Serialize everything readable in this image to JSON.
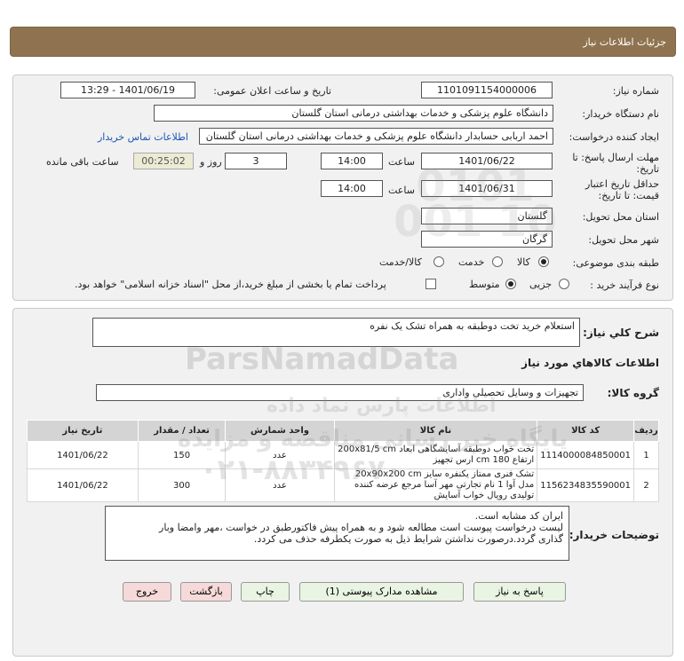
{
  "header": {
    "title": "جزئیات اطلاعات نیاز"
  },
  "info": {
    "need_number_label": "شماره نیاز:",
    "need_number": "1101091154000006",
    "announce_label": "تاریخ و ساعت اعلان عمومی:",
    "announce_value": "1401/06/19 - 13:29",
    "buyer_org_label": "نام دستگاه خریدار:",
    "buyer_org": "دانشگاه علوم پزشکی و خدمات بهداشتی درمانی استان گلستان",
    "creator_label": "ایجاد کننده درخواست:",
    "creator": "احمد اربابی حسابدار دانشگاه علوم پزشکی و خدمات بهداشتی درمانی استان گلستان",
    "contact_link": "اطلاعات تماس خریدار",
    "deadline_label_1": "مهلت ارسال پاسخ: تا",
    "deadline_label_2": "تاریخ:",
    "deadline_date": "1401/06/22",
    "time_label": "ساعت",
    "deadline_time": "14:00",
    "days_value": "3",
    "days_label": "روز و",
    "countdown": "00:25:02",
    "remaining_label": "ساعت باقی مانده",
    "validity_label_1": "حداقل تاریخ اعتبار",
    "validity_label_2": "قیمت: تا تاریخ:",
    "validity_date": "1401/06/31",
    "validity_time": "14:00",
    "province_label": "استان محل تحویل:",
    "province": "گلستان",
    "city_label": "شهر محل تحویل:",
    "city": "گرگان",
    "category_label": "طبقه بندی موضوعی:",
    "category_options": [
      "کالا",
      "خدمت",
      "کالا/خدمت"
    ],
    "process_label": "نوع فرآیند خرید :",
    "process_options": [
      "جزیی",
      "متوسط"
    ],
    "payment_note": "پرداخت تمام یا بخشی از مبلغ خرید،از محل \"اسناد خزانه اسلامی\" خواهد بود."
  },
  "summary": {
    "label": "شرح کلي نياز:",
    "value": "استعلام خرید تخت دوطبقه به همراه تشک یک نفره"
  },
  "goods": {
    "section_title": "اطلاعات کالاهاي مورد نياز",
    "group_label": "گروه کالا:",
    "group_value": "تجهیزات و وسایل تحصیلی واداری"
  },
  "table": {
    "headers": [
      "ردیف",
      "کد کالا",
      "نام کالا",
      "واحد شمارش",
      "تعداد / مقدار",
      "تاریخ نیاز"
    ],
    "rows": [
      {
        "index": "1",
        "code": "1114000084850001",
        "name": "تخت خواب دوطبقه آسایشگاهی ابعاد 200x81/5 cm ارتفاع 180 cm ارس تجهیز",
        "unit": "عدد",
        "qty": "150",
        "date": "1401/06/22"
      },
      {
        "index": "2",
        "code": "1156234835590001",
        "name": "تشک فنری ممتاز یکنفره سایز 20x90x200 cm مدل آوا 1 نام تجارتی مهر آسا مرجع عرضه کننده تولیدی رویال خواب آسایش",
        "unit": "عدد",
        "qty": "300",
        "date": "1401/06/22"
      }
    ]
  },
  "buyer_notes": {
    "label": "توضیحات خریدار:",
    "lines": [
      "ایران کد مشابه است.",
      "لیست درخواست پیوست است مطالعه شود و به همراه پیش فاکتورطبق در خواست ،مهر وامضا وبار",
      "گذاری گردد.درصورت نداشتن شرایط ذیل به صورت یکطرفه حذف می کردد."
    ]
  },
  "buttons": {
    "reply": "پاسخ به نیاز",
    "docs": "مشاهده مدارک پیوستی (1)",
    "print": "چاپ",
    "back": "بازگشت",
    "exit": "خروج"
  },
  "watermark": {
    "brand": "ParsNamadData",
    "line1": "پایگاه خبر رسانی مناقصه و مزایده",
    "line2": "۰۲۱-۸۸۳۴۹۶۷۰",
    "line3": "اطلاعات پارس نماد داده",
    "digits": "0101 001 10"
  },
  "colors": {
    "header_bg": "#8f7350",
    "panel_bg": "#f1f1f1",
    "button_green": "#e9f4e2",
    "button_red": "#f6d9d9",
    "link": "#1a55b5"
  }
}
